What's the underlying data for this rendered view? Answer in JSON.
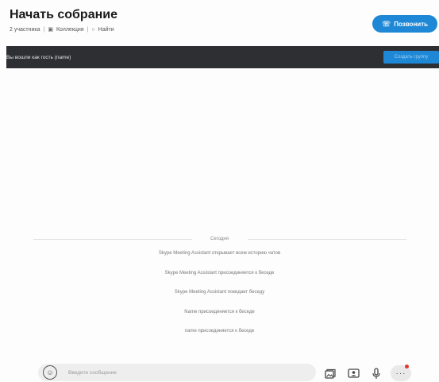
{
  "header": {
    "title": "Начать собрание",
    "participants": "2 участника",
    "gallery": "Коллекция",
    "find": "Найти",
    "call_button": "Позвонить",
    "gallery_icon": "gallery-icon",
    "find_icon": "search-icon"
  },
  "banner": {
    "text": "Вы вошли как гость (name)",
    "button": "Создать группу"
  },
  "chat": {
    "date": "Сегодня",
    "messages": [
      "Skype Meeting Assistant открывает всем историю чатов",
      "Skype Meeting Assistant присоединяется к беседе",
      "Skype Meeting Assistant покидает беседу",
      "Name присоединяется к беседе",
      "name присоединяется к беседе"
    ]
  },
  "composer": {
    "placeholder": "Введите сообщение"
  },
  "colors": {
    "accent": "#1e88d6",
    "banner_bg": "#2d2f33",
    "notification_dot": "#e0382d"
  }
}
